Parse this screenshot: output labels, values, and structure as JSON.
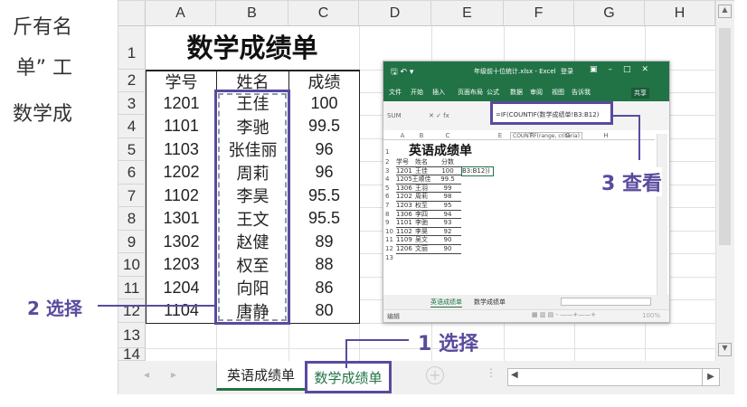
{
  "side_text": [
    "斤有名",
    "单” 工",
    "数学成"
  ],
  "main_sheet": {
    "columns": [
      "A",
      "B",
      "C",
      "D",
      "E",
      "F",
      "G",
      "H"
    ],
    "rows": [
      "1",
      "2",
      "3",
      "4",
      "5",
      "6",
      "7",
      "8",
      "9",
      "10",
      "11",
      "12",
      "13",
      "14"
    ],
    "title": "数学成绩单",
    "headers": [
      "学号",
      "姓名",
      "成绩"
    ],
    "data": [
      [
        "1201",
        "王佳",
        "100"
      ],
      [
        "1101",
        "李驰",
        "99.5"
      ],
      [
        "1103",
        "张佳丽",
        "96"
      ],
      [
        "1202",
        "周莉",
        "96"
      ],
      [
        "1102",
        "李昊",
        "95.5"
      ],
      [
        "1301",
        "王文",
        "95.5"
      ],
      [
        "1302",
        "赵健",
        "89"
      ],
      [
        "1203",
        "权至",
        "88"
      ],
      [
        "1204",
        "向阳",
        "86"
      ],
      [
        "1104",
        "唐静",
        "80"
      ]
    ],
    "tabs": [
      "英语成绩单",
      "数学成绩单"
    ],
    "active_tab": 1
  },
  "inset": {
    "title": "年级前十位统计.xlsx - Excel",
    "login": "登录",
    "ribbon": [
      "文件",
      "开始",
      "插入",
      "页面布局",
      "公式",
      "数据",
      "审阅",
      "视图",
      "告诉我",
      "共享"
    ],
    "name_box": "SUM",
    "formula": "=IF(COUNTIF(数学成绩单!B3:B12)",
    "formula_highlight": "B12",
    "tooltip": "COUNTIF(range, criteria)",
    "columns": [
      "A",
      "B",
      "C",
      "D",
      "E",
      "F",
      "G",
      "H"
    ],
    "title_cell": "英语成绩单",
    "headers": [
      "学号",
      "姓名",
      "分数"
    ],
    "data": [
      [
        "1201",
        "王佳",
        "100"
      ],
      [
        "1205",
        "王顺佳",
        "99.5"
      ],
      [
        "1306",
        "王羽",
        "99"
      ],
      [
        "1202",
        "周莉",
        "98"
      ],
      [
        "1203",
        "权至",
        "95"
      ],
      [
        "1306",
        "李四",
        "94"
      ],
      [
        "1101",
        "李驰",
        "93"
      ],
      [
        "1102",
        "李昊",
        "92"
      ],
      [
        "1109",
        "吴文",
        "90"
      ],
      [
        "1206",
        "文丽",
        "90"
      ]
    ],
    "edit_cell": "B3:B12))",
    "tabs": [
      "英语成绩单",
      "数学成绩单"
    ],
    "status": "编辑",
    "zoom": "100%"
  },
  "callouts": {
    "step1": "1 选择",
    "step2": "2 选择",
    "step3": "3 查看"
  },
  "colors": {
    "accent": "#5a4a9e",
    "excel_green": "#217346"
  }
}
